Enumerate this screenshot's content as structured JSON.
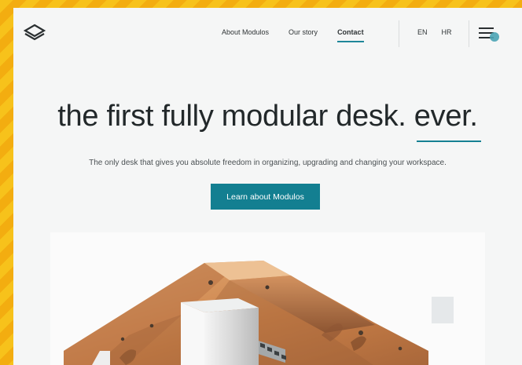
{
  "nav": {
    "links": [
      "About Modulos",
      "Our story",
      "Contact"
    ],
    "languages": [
      "EN",
      "HR"
    ]
  },
  "hero": {
    "title": "the first fully modular desk. ever.",
    "subtitle": "The only desk that gives you absolute freedom in organizing, upgrading and changing your workspace.",
    "cta": "Learn about Modulos"
  },
  "icons": {
    "logo": "modulos-logo-icon",
    "menu": "hamburger-menu-icon"
  },
  "colors": {
    "accent": "#137f91",
    "frame": "#f7c21b"
  }
}
